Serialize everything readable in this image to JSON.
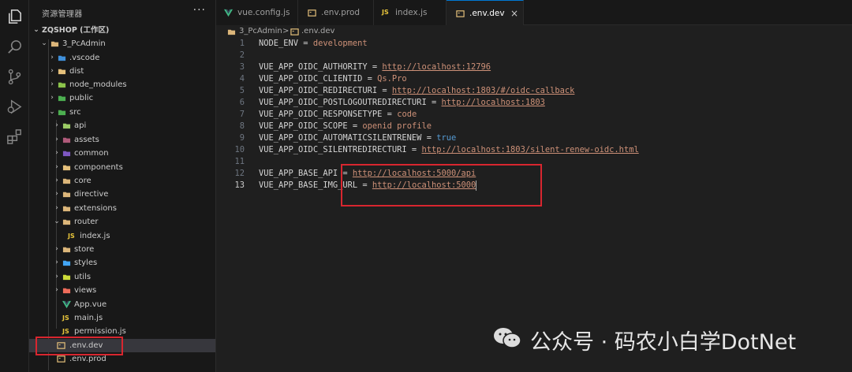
{
  "activity_bar": {
    "icons": [
      "explorer-icon",
      "search-icon",
      "source-control-icon",
      "run-debug-icon",
      "extensions-icon"
    ]
  },
  "explorer": {
    "title": "资源管理器",
    "more": "···",
    "workspace": "ZQSHOP (工作区)",
    "project": "3_PcAdmin",
    "items": [
      {
        "label": ".vscode",
        "type": "folder"
      },
      {
        "label": "dist",
        "type": "folder"
      },
      {
        "label": "node_modules",
        "type": "folder"
      },
      {
        "label": "public",
        "type": "folder"
      },
      {
        "label": "src",
        "type": "folder-open"
      },
      {
        "label": "api",
        "type": "folder"
      },
      {
        "label": "assets",
        "type": "folder"
      },
      {
        "label": "common",
        "type": "folder"
      },
      {
        "label": "components",
        "type": "folder"
      },
      {
        "label": "core",
        "type": "folder"
      },
      {
        "label": "directive",
        "type": "folder"
      },
      {
        "label": "extensions",
        "type": "folder"
      },
      {
        "label": "router",
        "type": "folder-open"
      },
      {
        "label": "index.js",
        "type": "js"
      },
      {
        "label": "store",
        "type": "folder"
      },
      {
        "label": "styles",
        "type": "folder"
      },
      {
        "label": "utils",
        "type": "folder"
      },
      {
        "label": "views",
        "type": "folder"
      },
      {
        "label": "App.vue",
        "type": "vue"
      },
      {
        "label": "main.js",
        "type": "js"
      },
      {
        "label": "permission.js",
        "type": "js"
      },
      {
        "label": ".env.dev",
        "type": "env"
      },
      {
        "label": ".env.prod",
        "type": "env"
      }
    ],
    "js_badge": "JS"
  },
  "tabs": [
    {
      "label": "vue.config.js",
      "icon": "vue-icon"
    },
    {
      "label": ".env.prod",
      "icon": "env-icon"
    },
    {
      "label": "index.js",
      "icon": "js-icon",
      "badge": "JS"
    },
    {
      "label": ".env.dev",
      "icon": "env-icon",
      "active": true,
      "close": "×"
    }
  ],
  "breadcrumb": {
    "folder": "3_PcAdmin",
    "separator": ">",
    "file": ".env.dev"
  },
  "editor": {
    "current_line": 13,
    "lines": [
      {
        "n": "1",
        "key": "NODE_ENV",
        "value": "development",
        "kind": "plain"
      },
      {
        "n": "2",
        "key": "",
        "value": "",
        "kind": "empty"
      },
      {
        "n": "3",
        "key": "VUE_APP_OIDC_AUTHORITY",
        "value": "http://localhost:12796",
        "kind": "url"
      },
      {
        "n": "4",
        "key": "VUE_APP_OIDC_CLIENTID",
        "value": "Qs.Pro",
        "kind": "plain"
      },
      {
        "n": "5",
        "key": "VUE_APP_OIDC_REDIRECTURI",
        "value": "http://localhost:1803/#/oidc-callback",
        "kind": "url"
      },
      {
        "n": "6",
        "key": "VUE_APP_OIDC_POSTLOGOUTREDIRECTURI",
        "value": "http://localhost:1803",
        "kind": "url"
      },
      {
        "n": "7",
        "key": "VUE_APP_OIDC_RESPONSETYPE",
        "value": "code",
        "kind": "plain"
      },
      {
        "n": "8",
        "key": "VUE_APP_OIDC_SCOPE",
        "value": "openid profile",
        "kind": "plain"
      },
      {
        "n": "9",
        "key": "VUE_APP_OIDC_AUTOMATICSILENTRENEW",
        "value": "true",
        "kind": "bool"
      },
      {
        "n": "10",
        "key": "VUE_APP_OIDC_SILENTREDIRECTURI",
        "value": "http://localhost:1803/silent-renew-oidc.html",
        "kind": "url"
      },
      {
        "n": "11",
        "key": "",
        "value": "",
        "kind": "empty"
      },
      {
        "n": "12",
        "key": "VUE_APP_BASE_API",
        "value": "http://localhost:5000/api",
        "kind": "url"
      },
      {
        "n": "13",
        "key": "VUE_APP_BASE_IMG_URL",
        "value": "http://localhost:5000",
        "kind": "url"
      }
    ],
    "equals": " = "
  },
  "watermark": {
    "text": "公众号 · 码农小白学DotNet"
  },
  "colors": {
    "accent": "#0078d4",
    "highlight_box": "#d8262f",
    "string": "#ce9178",
    "keyword": "#569cd6",
    "folder": "#dcb67a",
    "env": "#e5c07b"
  }
}
